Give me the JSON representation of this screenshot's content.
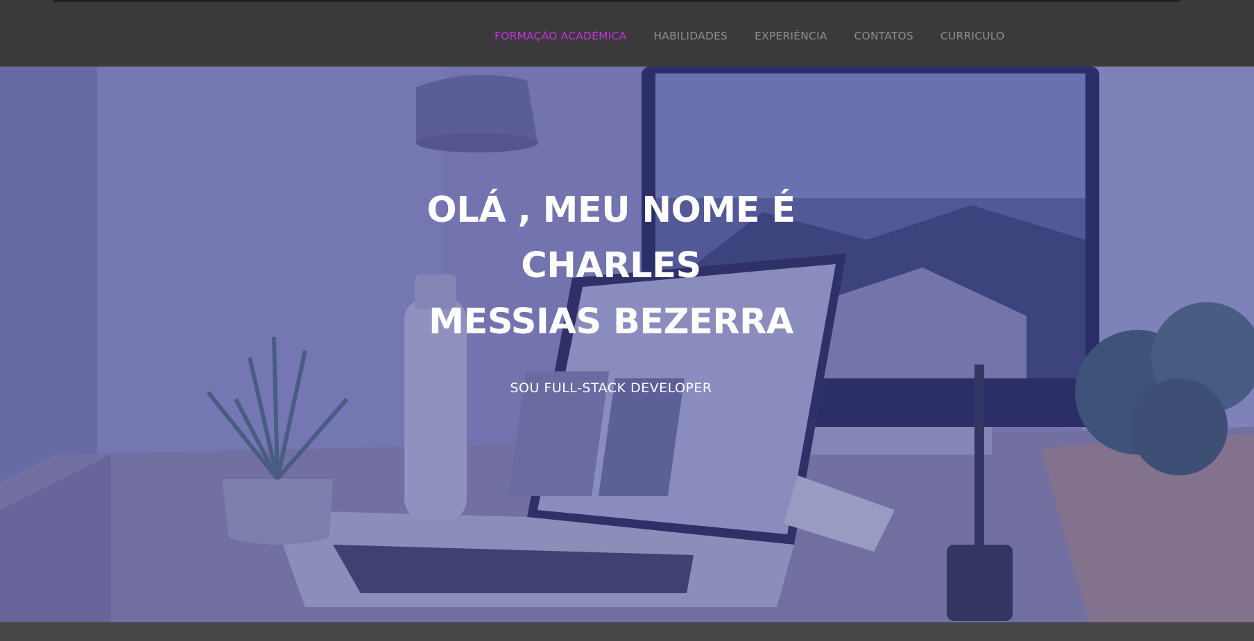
{
  "nav": {
    "items": [
      {
        "label": "FORMAÇÃO ACADÊMICA",
        "active": true
      },
      {
        "label": "HABILIDADES",
        "active": false
      },
      {
        "label": "EXPERIÊNCIA",
        "active": false
      },
      {
        "label": "CONTATOS",
        "active": false
      },
      {
        "label": "CURRICULO",
        "active": false
      }
    ],
    "active_color": "#c730e0",
    "inactive_color": "#8f8f8f"
  },
  "hero": {
    "title_line1": "OLÁ , MEU NOME É",
    "title_line2": "CHARLES",
    "title_line3": "MESSIAS BEZERRA",
    "subtitle": "SOU FULL-STACK DEVELOPER",
    "background_image": "desk-with-laptop-and-monitor-photo",
    "overlay_color": "#5c5ea0"
  },
  "colors": {
    "navbar_bg": "#3a3a3a",
    "page_bg": "#3d3d3d"
  }
}
